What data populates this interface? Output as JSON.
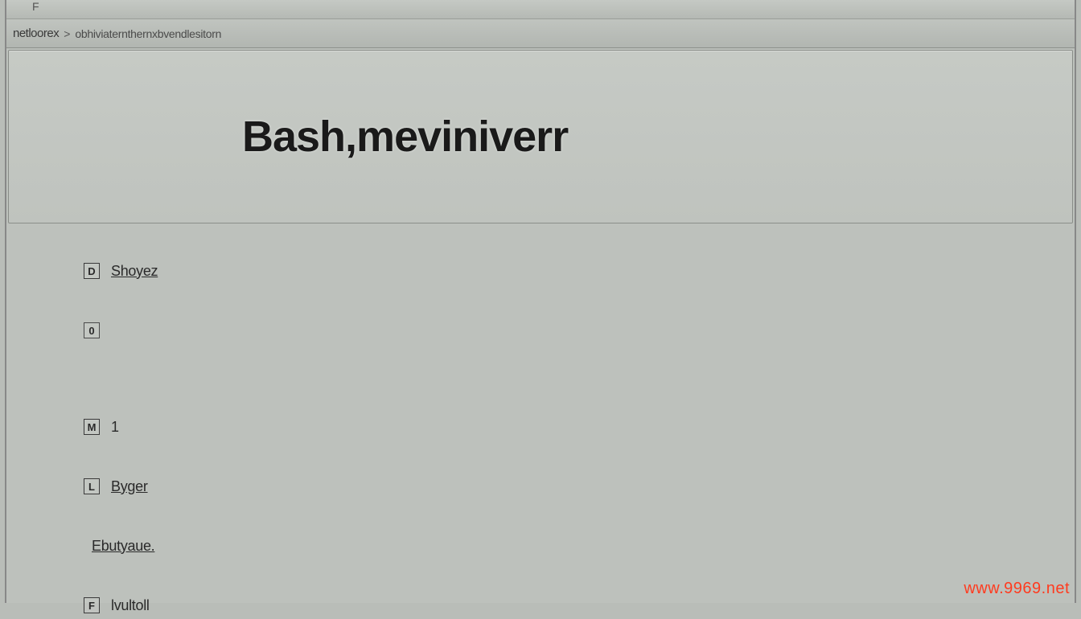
{
  "topbar": {
    "marker": "F"
  },
  "breadcrumb": {
    "label": "netloorex",
    "separator": ">",
    "path": "obhiviaternthernxbvendlesitorn"
  },
  "title": {
    "text": "Bash,meviniverr"
  },
  "list": {
    "items": [
      {
        "marker": "D",
        "label": "Shoyez"
      },
      {
        "marker": "0",
        "label": ""
      },
      {
        "marker": "M",
        "label": "1"
      },
      {
        "marker": "L",
        "label": "Byger"
      },
      {
        "marker": "",
        "label": "Ebutyaue."
      },
      {
        "marker": "F",
        "label": "lvultoll"
      }
    ]
  },
  "watermark": "www.9969.net"
}
